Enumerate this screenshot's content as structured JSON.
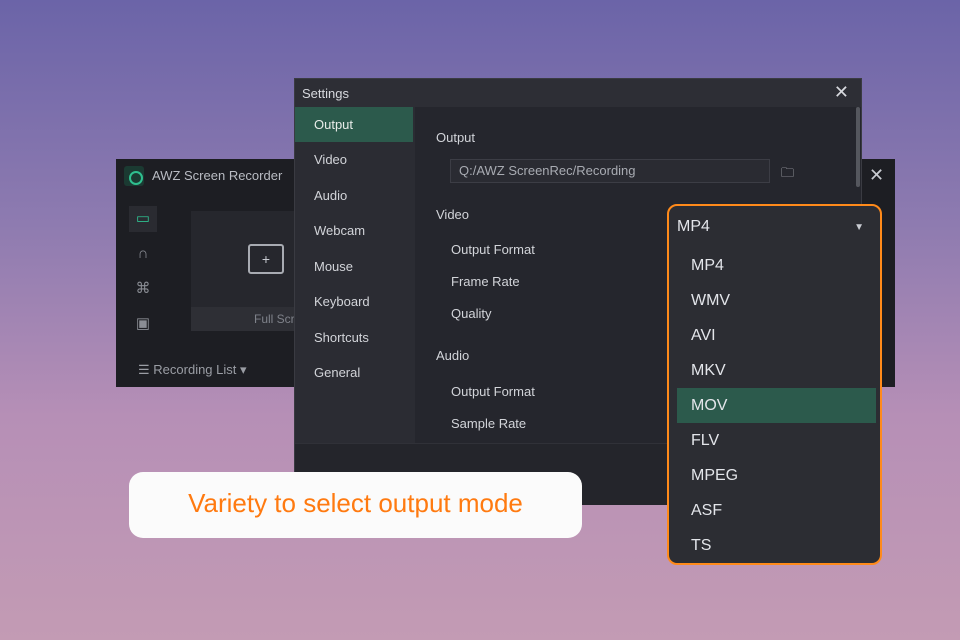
{
  "recorder": {
    "title": "AWZ Screen Recorder",
    "full_screen": "Full Scree",
    "recording_list": "Recording List",
    "close": "✕"
  },
  "settings": {
    "title": "Settings",
    "close": "✕",
    "nav": [
      "Output",
      "Video",
      "Audio",
      "Webcam",
      "Mouse",
      "Keyboard",
      "Shortcuts",
      "General"
    ],
    "output_heading": "Output",
    "output_path": "Q:/AWZ ScreenRec/Recording",
    "video_heading": "Video",
    "video_output_format": "Output Format",
    "frame_rate": "Frame Rate",
    "quality": "Quality",
    "audio_heading": "Audio",
    "audio_output_format": "Output Format",
    "sample_rate": "Sample Rate"
  },
  "dropdown": {
    "selected": "MP4",
    "options": [
      "MP4",
      "WMV",
      "AVI",
      "MKV",
      "MOV",
      "FLV",
      "MPEG",
      "ASF",
      "TS"
    ],
    "highlighted": "MOV"
  },
  "caption": "Variety to select output mode",
  "colors": {
    "accent": "#ff8a1a",
    "highlight": "#2c5a4c"
  }
}
